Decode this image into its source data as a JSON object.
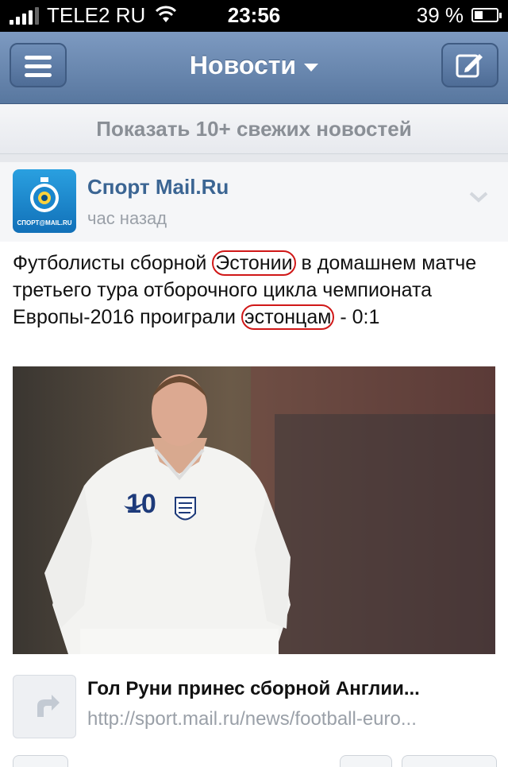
{
  "status_bar": {
    "carrier": "TELE2 RU",
    "time": "23:56",
    "battery_percent": "39 %",
    "battery_level": 0.39,
    "signal_icon": "signal-bars-icon",
    "wifi_icon": "wifi-icon"
  },
  "nav": {
    "title": "Новости",
    "menu_icon": "hamburger-menu-icon",
    "compose_icon": "compose-icon"
  },
  "fresh_news": {
    "label": "Показать 10+ свежих новостей"
  },
  "post": {
    "source": "Спорт Mail.Ru",
    "avatar_text": "СПОРТ@MAIL.RU",
    "time": "час назад",
    "text_part1": "Футболисты сборной ",
    "text_highlight1": "Эстонии",
    "text_part2": " в домашнем матче третьего тура отборочного цикла чемпионата Европы-2016 проиграли ",
    "text_highlight2": "эстонцам",
    "text_part3": " - 0:1",
    "jersey_number": "10",
    "link": {
      "title": "Гол Руни принес сборной Англии...",
      "url": "http://sport.mail.ru/news/football-euro..."
    }
  },
  "colors": {
    "nav_bar": "#6886ad",
    "source_blue": "#3b6593",
    "highlight_red": "#d01818"
  }
}
